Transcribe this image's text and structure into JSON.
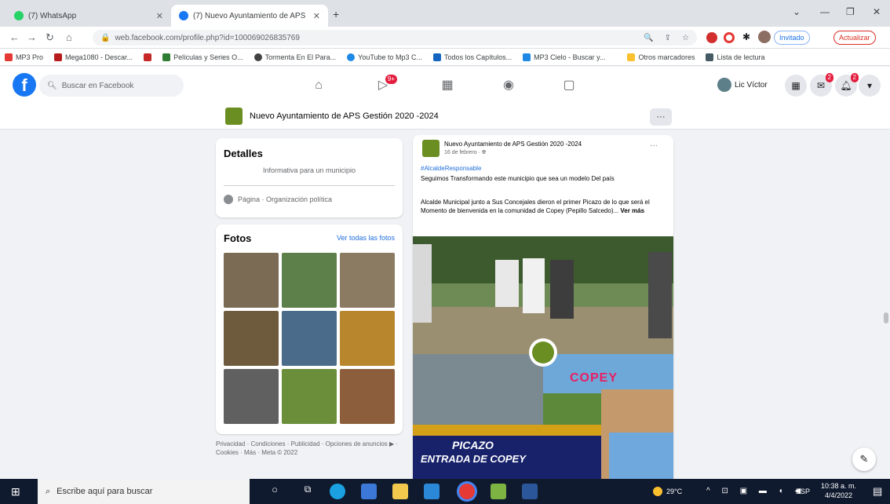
{
  "browser": {
    "tabs": [
      {
        "title": "(7) WhatsApp"
      },
      {
        "title": "(7) Nuevo Ayuntamiento de APS"
      }
    ],
    "new_tab_symbol": "+",
    "url": "web.facebook.com/profile.php?id=100069026835769",
    "incognito_label": "Invitado",
    "update_label": "Actualizar"
  },
  "bookmarks": [
    {
      "label": "MP3 Pro",
      "color": "#e53935"
    },
    {
      "label": "Mega1080 - Descar...",
      "color": "#b71c1c"
    },
    {
      "label": "",
      "color": "#c62828"
    },
    {
      "label": "Películas y Series O...",
      "color": "#2e7d32"
    },
    {
      "label": "Tormenta En El Para...",
      "color": "#424242"
    },
    {
      "label": "YouTube to Mp3 C...",
      "color": "#1e88e5"
    },
    {
      "label": "Todos los Capítulos...",
      "color": "#1565c0"
    },
    {
      "label": "MP3 Cielo - Buscar y...",
      "color": "#1e88e5"
    },
    {
      "label": "Otros marcadores",
      "color": "#fbc02d"
    },
    {
      "label": "Lista de lectura",
      "color": "#455a64"
    }
  ],
  "facebook": {
    "search_placeholder": "Buscar en Facebook",
    "watch_badge": "9+",
    "user_name": "Lic Víctor",
    "messenger_badge": "2",
    "notif_badge": "2"
  },
  "page": {
    "name": "Nuevo Ayuntamiento de APS Gestión 2020 -2024",
    "more": "···"
  },
  "details": {
    "title": "Detalles",
    "description": "Informativa para un municipio",
    "category": "Página · Organización política"
  },
  "photos": {
    "title": "Fotos",
    "see_all": "Ver todas las fotos",
    "tiles": [
      {
        "color": "#7b6a54"
      },
      {
        "color": "#5d7f4a"
      },
      {
        "color": "#8a7b62"
      },
      {
        "color": "#6e5a3c"
      },
      {
        "color": "#4a6b8a"
      },
      {
        "color": "#b8862d"
      },
      {
        "color": "#606060"
      },
      {
        "color": "#6b8e3a"
      },
      {
        "color": "#8c5e3c"
      }
    ]
  },
  "footer": "Privacidad · Condiciones · Publicidad · Opciones de anuncios ▶ · Cookies · Más · Meta © 2022",
  "post": {
    "author": "Nuevo Ayuntamiento de APS Gestión 2020 -2024",
    "date": "16 de febrero",
    "more": "···",
    "hashtag": "#AlcaldeResponsable",
    "line1": "Seguimos Transformando este municipio que sea un modelo Del país",
    "line2": "Alcalde Municipal junto a Sus Concejales dieron el primer Picazo de lo que será el Momento de bienvenida en la comunidad de Copey (Pepillo Salcedo)...",
    "see_more": "Ver más",
    "banner_line1": "PICAZO",
    "banner_line2": "ENTRADA DE COPEY",
    "sign_text": "COPEY"
  },
  "taskbar": {
    "search_placeholder": "Escribe aquí para buscar",
    "weather": "29°C",
    "language": "ESP",
    "time": "10:38 a. m.",
    "date": "4/4/2022"
  }
}
